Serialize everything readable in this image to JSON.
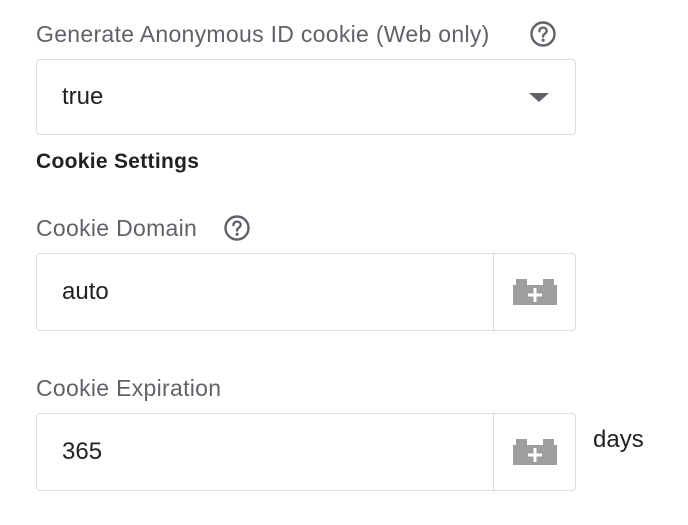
{
  "anonymous_id": {
    "label": "Generate Anonymous ID cookie (Web only)",
    "help_icon": "help-circle-icon",
    "value": "true"
  },
  "cookie_settings": {
    "title": "Cookie Settings",
    "domain": {
      "label": "Cookie Domain",
      "help_icon": "help-circle-icon",
      "value": "auto",
      "variable_icon": "variable-brick-plus-icon"
    },
    "expiration": {
      "label": "Cookie Expiration",
      "value": "365",
      "variable_icon": "variable-brick-plus-icon",
      "suffix": "days"
    }
  },
  "colors": {
    "label": "#5f6368",
    "text": "#202124",
    "border": "#dadce0",
    "icon": "#9e9e9e"
  }
}
